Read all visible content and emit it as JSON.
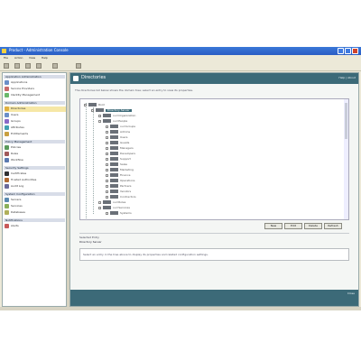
{
  "colors": {
    "titlebar": "#2a5cc4",
    "header": "#3c6a78",
    "selection": "#f6e7a6"
  },
  "window": {
    "title": "Product - Administration Console"
  },
  "menu": [
    "File",
    "Action",
    "View",
    "Help"
  ],
  "toolbar_icons": [
    "back-icon",
    "forward-icon",
    "refresh-icon",
    "up-icon",
    "properties-icon",
    "help-icon"
  ],
  "sidebar": {
    "groups": [
      {
        "title": "Application Administration",
        "items": [
          {
            "label": "Applications",
            "icon": "applications-icon",
            "color": "#6a8fc8"
          },
          {
            "label": "Service Providers",
            "icon": "providers-icon",
            "color": "#c86a6a"
          },
          {
            "label": "Identity Management",
            "icon": "identity-icon",
            "color": "#6ab86a"
          }
        ]
      },
      {
        "title": "Domain Administration",
        "items": [
          {
            "label": "Directories",
            "icon": "folder-icon",
            "color": "#e0b040",
            "selected": true
          },
          {
            "label": "Users",
            "icon": "users-icon",
            "color": "#6a8fc8"
          },
          {
            "label": "Groups",
            "icon": "groups-icon",
            "color": "#8a6ac8"
          },
          {
            "label": "Attributes",
            "icon": "attributes-icon",
            "color": "#40a0b0"
          },
          {
            "label": "Entitlements",
            "icon": "entitlements-icon",
            "color": "#c8a040"
          }
        ]
      },
      {
        "title": "Policy Management",
        "items": [
          {
            "label": "Policies",
            "icon": "policy-icon",
            "color": "#5a9a5a"
          },
          {
            "label": "Rules",
            "icon": "rules-icon",
            "color": "#a05a5a"
          },
          {
            "label": "Workflow",
            "icon": "workflow-icon",
            "color": "#5a7ab0"
          }
        ]
      },
      {
        "title": "Security Settings",
        "items": [
          {
            "label": "Certificates",
            "icon": "certificate-icon",
            "color": "#303030"
          },
          {
            "label": "Trusted Authorities",
            "icon": "authority-icon",
            "color": "#b06a30"
          },
          {
            "label": "Audit Log",
            "icon": "log-icon",
            "color": "#6a6a9a"
          }
        ]
      },
      {
        "title": "System Configuration",
        "items": [
          {
            "label": "Servers",
            "icon": "server-icon",
            "color": "#5a8ab0"
          },
          {
            "label": "Services",
            "icon": "services-icon",
            "color": "#8ab05a"
          },
          {
            "label": "Databases",
            "icon": "database-icon",
            "color": "#b0b05a"
          }
        ]
      },
      {
        "title": "Notifications",
        "items": [
          {
            "label": "Alerts",
            "icon": "alert-icon",
            "color": "#c85a5a"
          }
        ]
      }
    ]
  },
  "main": {
    "title": "Directories",
    "header_link": "Help | About",
    "description": "The directories list below shows the domain tree; select an entry to view its properties.",
    "tree": [
      {
        "label": "Root",
        "depth": 0,
        "row": 0
      },
      {
        "label": "Directory Server",
        "depth": 1,
        "row": 1,
        "selected": true
      },
      {
        "label": "ou=Organization",
        "depth": 2,
        "row": 2
      },
      {
        "label": "ou=People",
        "depth": 2,
        "row": 3
      },
      {
        "label": "ou=Groups",
        "depth": 3,
        "row": 4
      },
      {
        "label": "Admins",
        "depth": 3,
        "row": 5
      },
      {
        "label": "Users",
        "depth": 3,
        "row": 6
      },
      {
        "label": "Guests",
        "depth": 3,
        "row": 7
      },
      {
        "label": "Managers",
        "depth": 3,
        "row": 8
      },
      {
        "label": "Developers",
        "depth": 3,
        "row": 9
      },
      {
        "label": "Support",
        "depth": 3,
        "row": 10
      },
      {
        "label": "Sales",
        "depth": 3,
        "row": 11
      },
      {
        "label": "Marketing",
        "depth": 3,
        "row": 12
      },
      {
        "label": "Finance",
        "depth": 3,
        "row": 13
      },
      {
        "label": "Operations",
        "depth": 3,
        "row": 14
      },
      {
        "label": "Partners",
        "depth": 3,
        "row": 15
      },
      {
        "label": "Vendors",
        "depth": 3,
        "row": 16
      },
      {
        "label": "Contractors",
        "depth": 3,
        "row": 17
      },
      {
        "label": "ou=Roles",
        "depth": 2,
        "row": 18
      },
      {
        "label": "ou=Services",
        "depth": 2,
        "row": 19
      },
      {
        "label": "Systems",
        "depth": 3,
        "row": 20
      }
    ],
    "buttons": [
      "New",
      "Edit",
      "Delete",
      "Refresh"
    ],
    "info_label": "Selected Entry",
    "info_value": "Directory Server",
    "info_text": "Select an entry in the tree above to display its properties and related configuration settings."
  },
  "footer_link": "Close"
}
